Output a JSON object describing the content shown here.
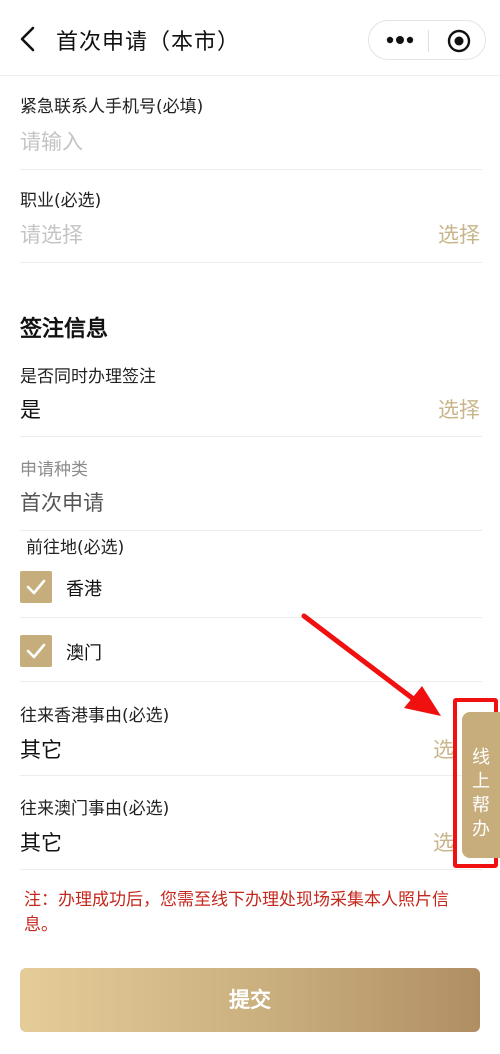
{
  "header": {
    "title": "首次申请（本市）",
    "more_icon": "more-dots-icon",
    "close_icon": "target-circle-icon"
  },
  "fields": {
    "emergency_phone": {
      "label": "紧急联系人手机号(必填)",
      "placeholder": "请输入"
    },
    "occupation": {
      "label": "职业(必选)",
      "placeholder": "请选择",
      "action": "选择"
    }
  },
  "visa_section": {
    "title": "签注信息",
    "same_time": {
      "label": "是否同时办理签注",
      "value": "是",
      "action": "选择"
    },
    "apply_type": {
      "label": "申请种类",
      "value": "首次申请"
    },
    "destination": {
      "label": "前往地(必选)",
      "options": [
        {
          "label": "香港",
          "checked": true
        },
        {
          "label": "澳门",
          "checked": true
        }
      ]
    },
    "hk_reason": {
      "label": "往来香港事由(必选)",
      "value": "其它",
      "action": "选"
    },
    "macau_reason": {
      "label": "往来澳门事由(必选)",
      "value": "其它",
      "action": "选"
    }
  },
  "notice": "注：办理成功后，您需至线下办理处现场采集本人照片信息。",
  "submit_label": "提交",
  "help_button": {
    "label": "线上帮办"
  },
  "colors": {
    "accent": "#c8b58a",
    "checkbox": "#c6ad7c",
    "notice": "#c4281d",
    "annotation": "#f01010"
  }
}
